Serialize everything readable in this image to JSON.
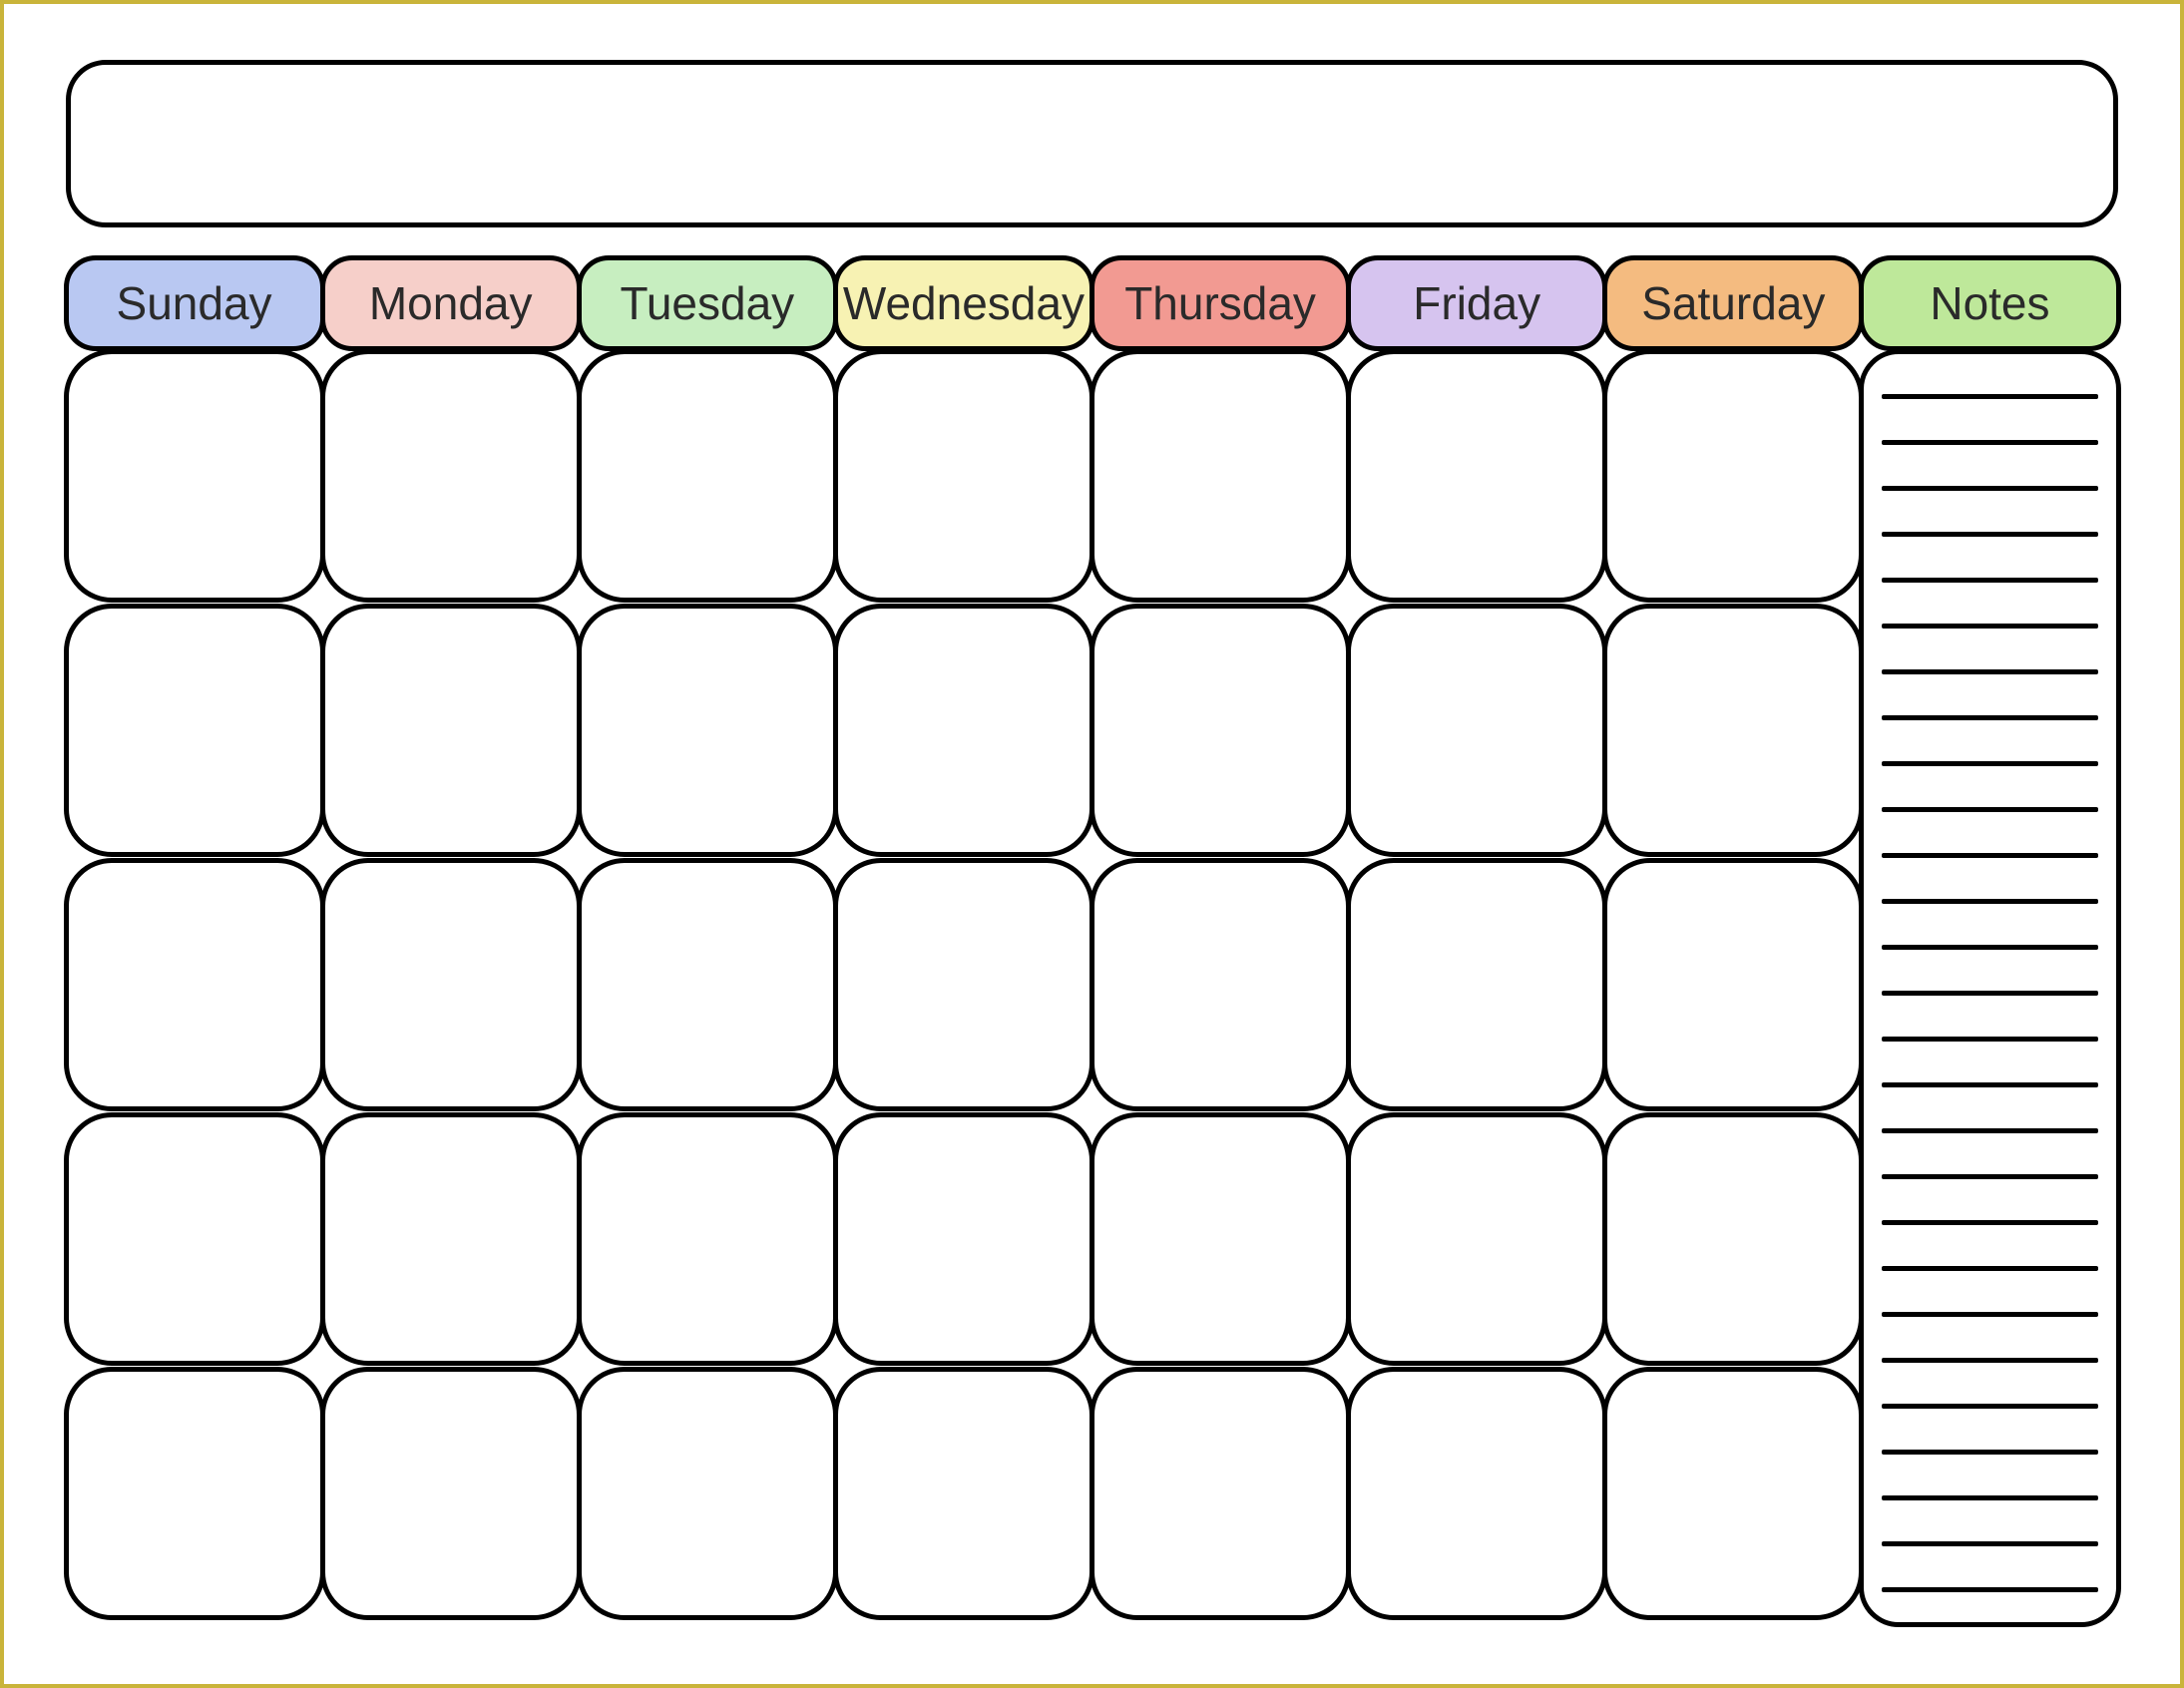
{
  "title": "",
  "headers": {
    "sunday": {
      "label": "Sunday",
      "bg": "#b9c8f2"
    },
    "monday": {
      "label": "Monday",
      "bg": "#f6cfc9"
    },
    "tuesday": {
      "label": "Tuesday",
      "bg": "#c7eec0"
    },
    "wednesday": {
      "label": "Wednesday",
      "bg": "#f7f2b3"
    },
    "thursday": {
      "label": "Thursday",
      "bg": "#f29a92"
    },
    "friday": {
      "label": "Friday",
      "bg": "#d6c4ef"
    },
    "saturday": {
      "label": "Saturday",
      "bg": "#f4bb80"
    },
    "notes": {
      "label": "Notes",
      "bg": "#bee89a"
    }
  },
  "rows": 5,
  "note_lines": 27
}
